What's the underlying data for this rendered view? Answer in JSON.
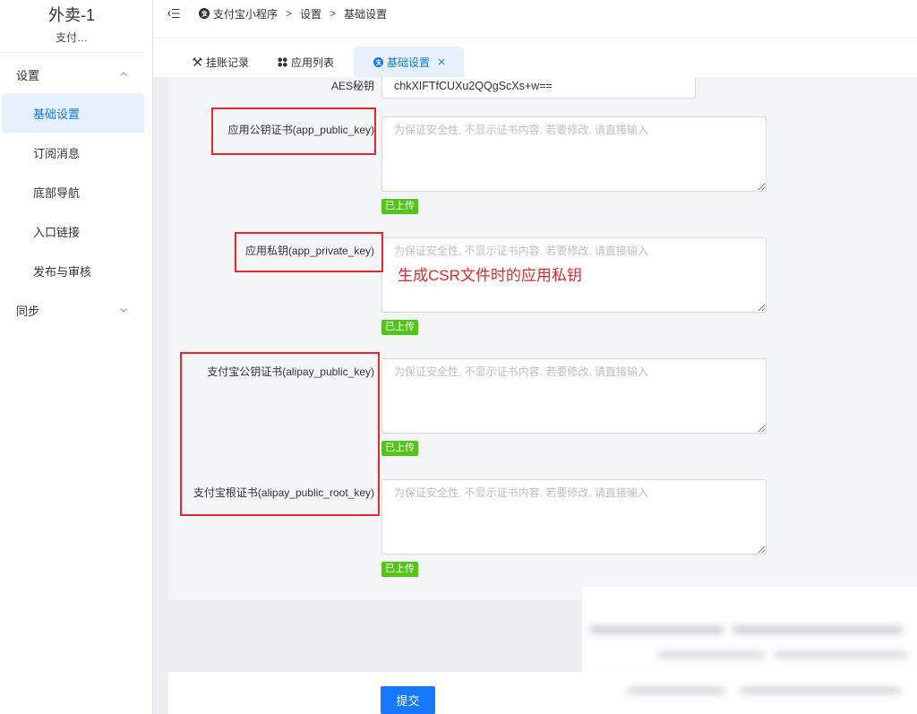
{
  "theme": {
    "accent": "#1677ff",
    "active_bg": "#e6f1fc",
    "success": "#52c41a",
    "annotation_red": "#e8262b"
  },
  "sidebar": {
    "app_title": "外卖-1",
    "app_subtitle": "支付…",
    "groups": [
      {
        "label": "设置",
        "expanded": true,
        "items": [
          {
            "label": "基础设置",
            "active": true
          },
          {
            "label": "订阅消息"
          },
          {
            "label": "底部导航"
          },
          {
            "label": "入口链接"
          },
          {
            "label": "发布与审核"
          }
        ]
      },
      {
        "label": "同步",
        "expanded": false
      }
    ]
  },
  "breadcrumb": {
    "icon": "alipay-icon",
    "separator": ">",
    "items": [
      "支付宝小程序",
      "设置",
      "基础设置"
    ]
  },
  "tabs": [
    {
      "label": "挂账记录",
      "icon": "tool-icon"
    },
    {
      "label": "应用列表",
      "icon": "grid-icon"
    },
    {
      "label": "基础设置",
      "icon": "alipay-icon",
      "active": true,
      "closable": true
    }
  ],
  "form": {
    "aes_key": {
      "label": "AES秘钥",
      "value": "chkXIFTfCUXu2QQgScXs+w=="
    },
    "cert_fields": [
      {
        "label": "应用公钥证书(app_public_key)",
        "placeholder": "为保证安全性, 不显示证书内容. 若要修改, 请直接输入",
        "status": "已上传"
      },
      {
        "label": "应用私钥(app_private_key)",
        "placeholder": "为保证安全性, 不显示证书内容. 若要修改, 请直接输入",
        "status": "已上传"
      },
      {
        "label": "支付宝公钥证书(alipay_public_key)",
        "placeholder": "为保证安全性, 不显示证书内容. 若要修改, 请直接输入",
        "status": "已上传"
      },
      {
        "label": "支付宝根证书(alipay_public_root_key)",
        "placeholder": "为保证安全性, 不显示证书内容. 若要修改, 请直接输入",
        "status": "已上传"
      }
    ]
  },
  "annotation": {
    "text": "生成CSR文件时的应用私钥"
  },
  "footer": {
    "submit_label": "提交"
  }
}
